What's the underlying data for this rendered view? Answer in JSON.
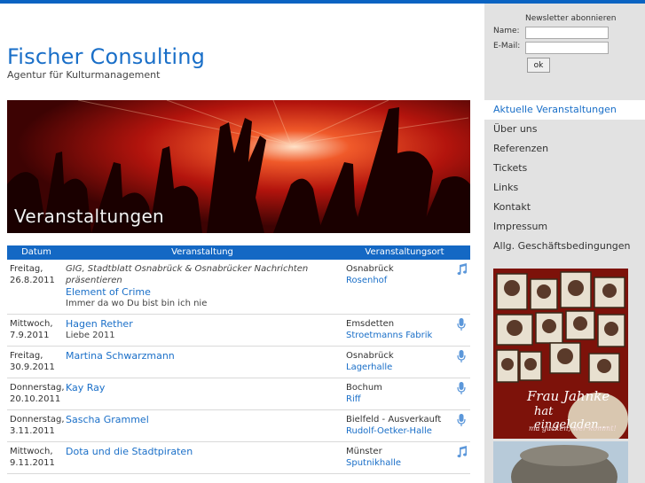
{
  "brand": {
    "title": "Fischer Consulting",
    "subtitle": "Agentur für Kulturmanagement"
  },
  "hero": {
    "caption": "Veranstaltungen"
  },
  "events": {
    "headers": {
      "date": "Datum",
      "event": "Veranstaltung",
      "venue": "Veranstaltungsort"
    },
    "rows": [
      {
        "day": "Freitag,",
        "date": "26.8.2011",
        "presenter": "GIG, Stadtblatt Osnabrück & Osnabrücker Nachrichten präsentieren",
        "artist": "Element of Crime",
        "detail": "Immer da wo Du bist bin ich nie",
        "city": "Osnabrück",
        "venue": "Rosenhof",
        "icon": "music-note-icon"
      },
      {
        "day": "Mittwoch,",
        "date": "7.9.2011",
        "presenter": "",
        "artist": "Hagen Rether",
        "detail": "Liebe 2011",
        "city": "Emsdetten",
        "venue": "Stroetmanns Fabrik",
        "icon": "microphone-icon"
      },
      {
        "day": "Freitag,",
        "date": "30.9.2011",
        "presenter": "",
        "artist": "Martina Schwarzmann",
        "detail": "",
        "city": "Osnabrück",
        "venue": "Lagerhalle",
        "icon": "microphone-icon"
      },
      {
        "day": "Donnerstag,",
        "date": "20.10.2011",
        "presenter": "",
        "artist": "Kay Ray",
        "detail": "",
        "city": "Bochum",
        "venue": "Riff",
        "icon": "microphone-icon"
      },
      {
        "day": "Donnerstag,",
        "date": "3.11.2011",
        "presenter": "",
        "artist": "Sascha Grammel",
        "detail": "",
        "city": "Bielfeld - Ausverkauft",
        "venue": "Rudolf-Oetker-Halle",
        "icon": "microphone-icon"
      },
      {
        "day": "Mittwoch,",
        "date": "9.11.2011",
        "presenter": "",
        "artist": "Dota und die Stadtpiraten",
        "detail": "",
        "city": "Münster",
        "venue": "Sputnikhalle",
        "icon": "music-note-icon"
      }
    ]
  },
  "newsletter": {
    "title": "Newsletter abonnieren",
    "name_label": "Name:",
    "email_label": "E-Mail:",
    "name_value": "",
    "email_value": "",
    "submit_label": "ok"
  },
  "nav": {
    "items": [
      {
        "label": "Aktuelle Veranstaltungen",
        "active": true
      },
      {
        "label": "Über uns",
        "active": false
      },
      {
        "label": "Referenzen",
        "active": false
      },
      {
        "label": "Tickets",
        "active": false
      },
      {
        "label": "Links",
        "active": false
      },
      {
        "label": "Kontakt",
        "active": false
      },
      {
        "label": "Impressum",
        "active": false
      },
      {
        "label": "Allg. Geschäftsbedingungen",
        "active": false
      }
    ]
  },
  "ad": {
    "line1": "Frau Jahnke",
    "line2": "hat eingeladen...",
    "line3": "ma gucken, wer kommt!"
  },
  "colors": {
    "accent": "#1468c4",
    "link": "#1a6fc8",
    "sidebar": "#e2e2e2"
  }
}
